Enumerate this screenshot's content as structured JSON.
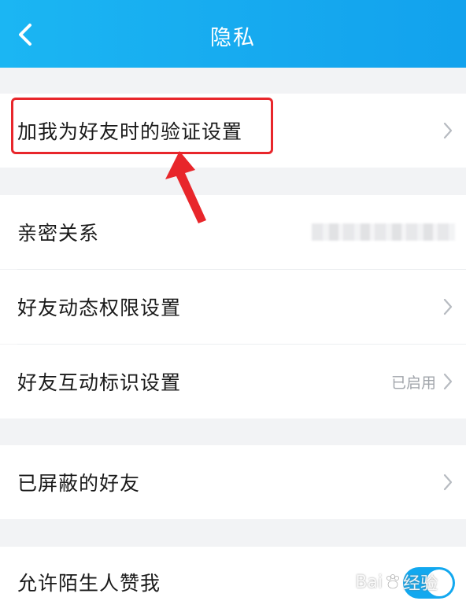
{
  "header": {
    "title": "隐私",
    "back_icon": "chevron-left-icon"
  },
  "sections": {
    "verify": {
      "label": "加我为好友时的验证设置"
    },
    "intimate": {
      "label": "亲密关系"
    },
    "feed_perm": {
      "label": "好友动态权限设置"
    },
    "interaction": {
      "label": "好友互动标识设置",
      "value": "已启用"
    },
    "blocked": {
      "label": "已屏蔽的好友"
    },
    "likes": {
      "label": "允许陌生人赞我",
      "toggle_on": true
    }
  },
  "watermark": {
    "text_left": "Bai",
    "text_right": "经验"
  },
  "colors": {
    "accent": "#12a8ef",
    "highlight": "#e8262b"
  }
}
